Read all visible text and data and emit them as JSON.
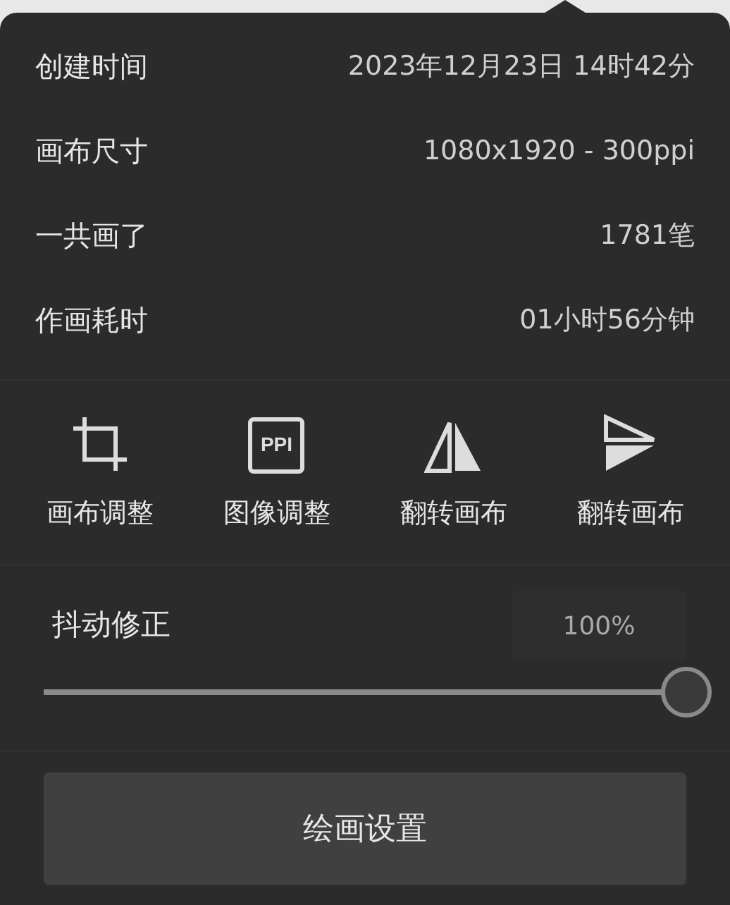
{
  "info_rows": [
    {
      "label": "创建时间",
      "value": "2023年12月23日 14时42分"
    },
    {
      "label": "画布尺寸",
      "value": "1080x1920 - 300ppi"
    },
    {
      "label": "一共画了",
      "value": "1781笔"
    },
    {
      "label": "作画耗时",
      "value": "01小时56分钟"
    }
  ],
  "tools": [
    {
      "kind": "crop",
      "label": "画布调整"
    },
    {
      "kind": "ppi",
      "icon_text": "PPI",
      "label": "图像调整"
    },
    {
      "kind": "flip_h",
      "label": "翻转画布"
    },
    {
      "kind": "flip_v",
      "label": "翻转画布"
    }
  ],
  "stabilizer": {
    "label": "抖动修正",
    "reading": "100%",
    "level": 1
  },
  "button": "绘画设置"
}
